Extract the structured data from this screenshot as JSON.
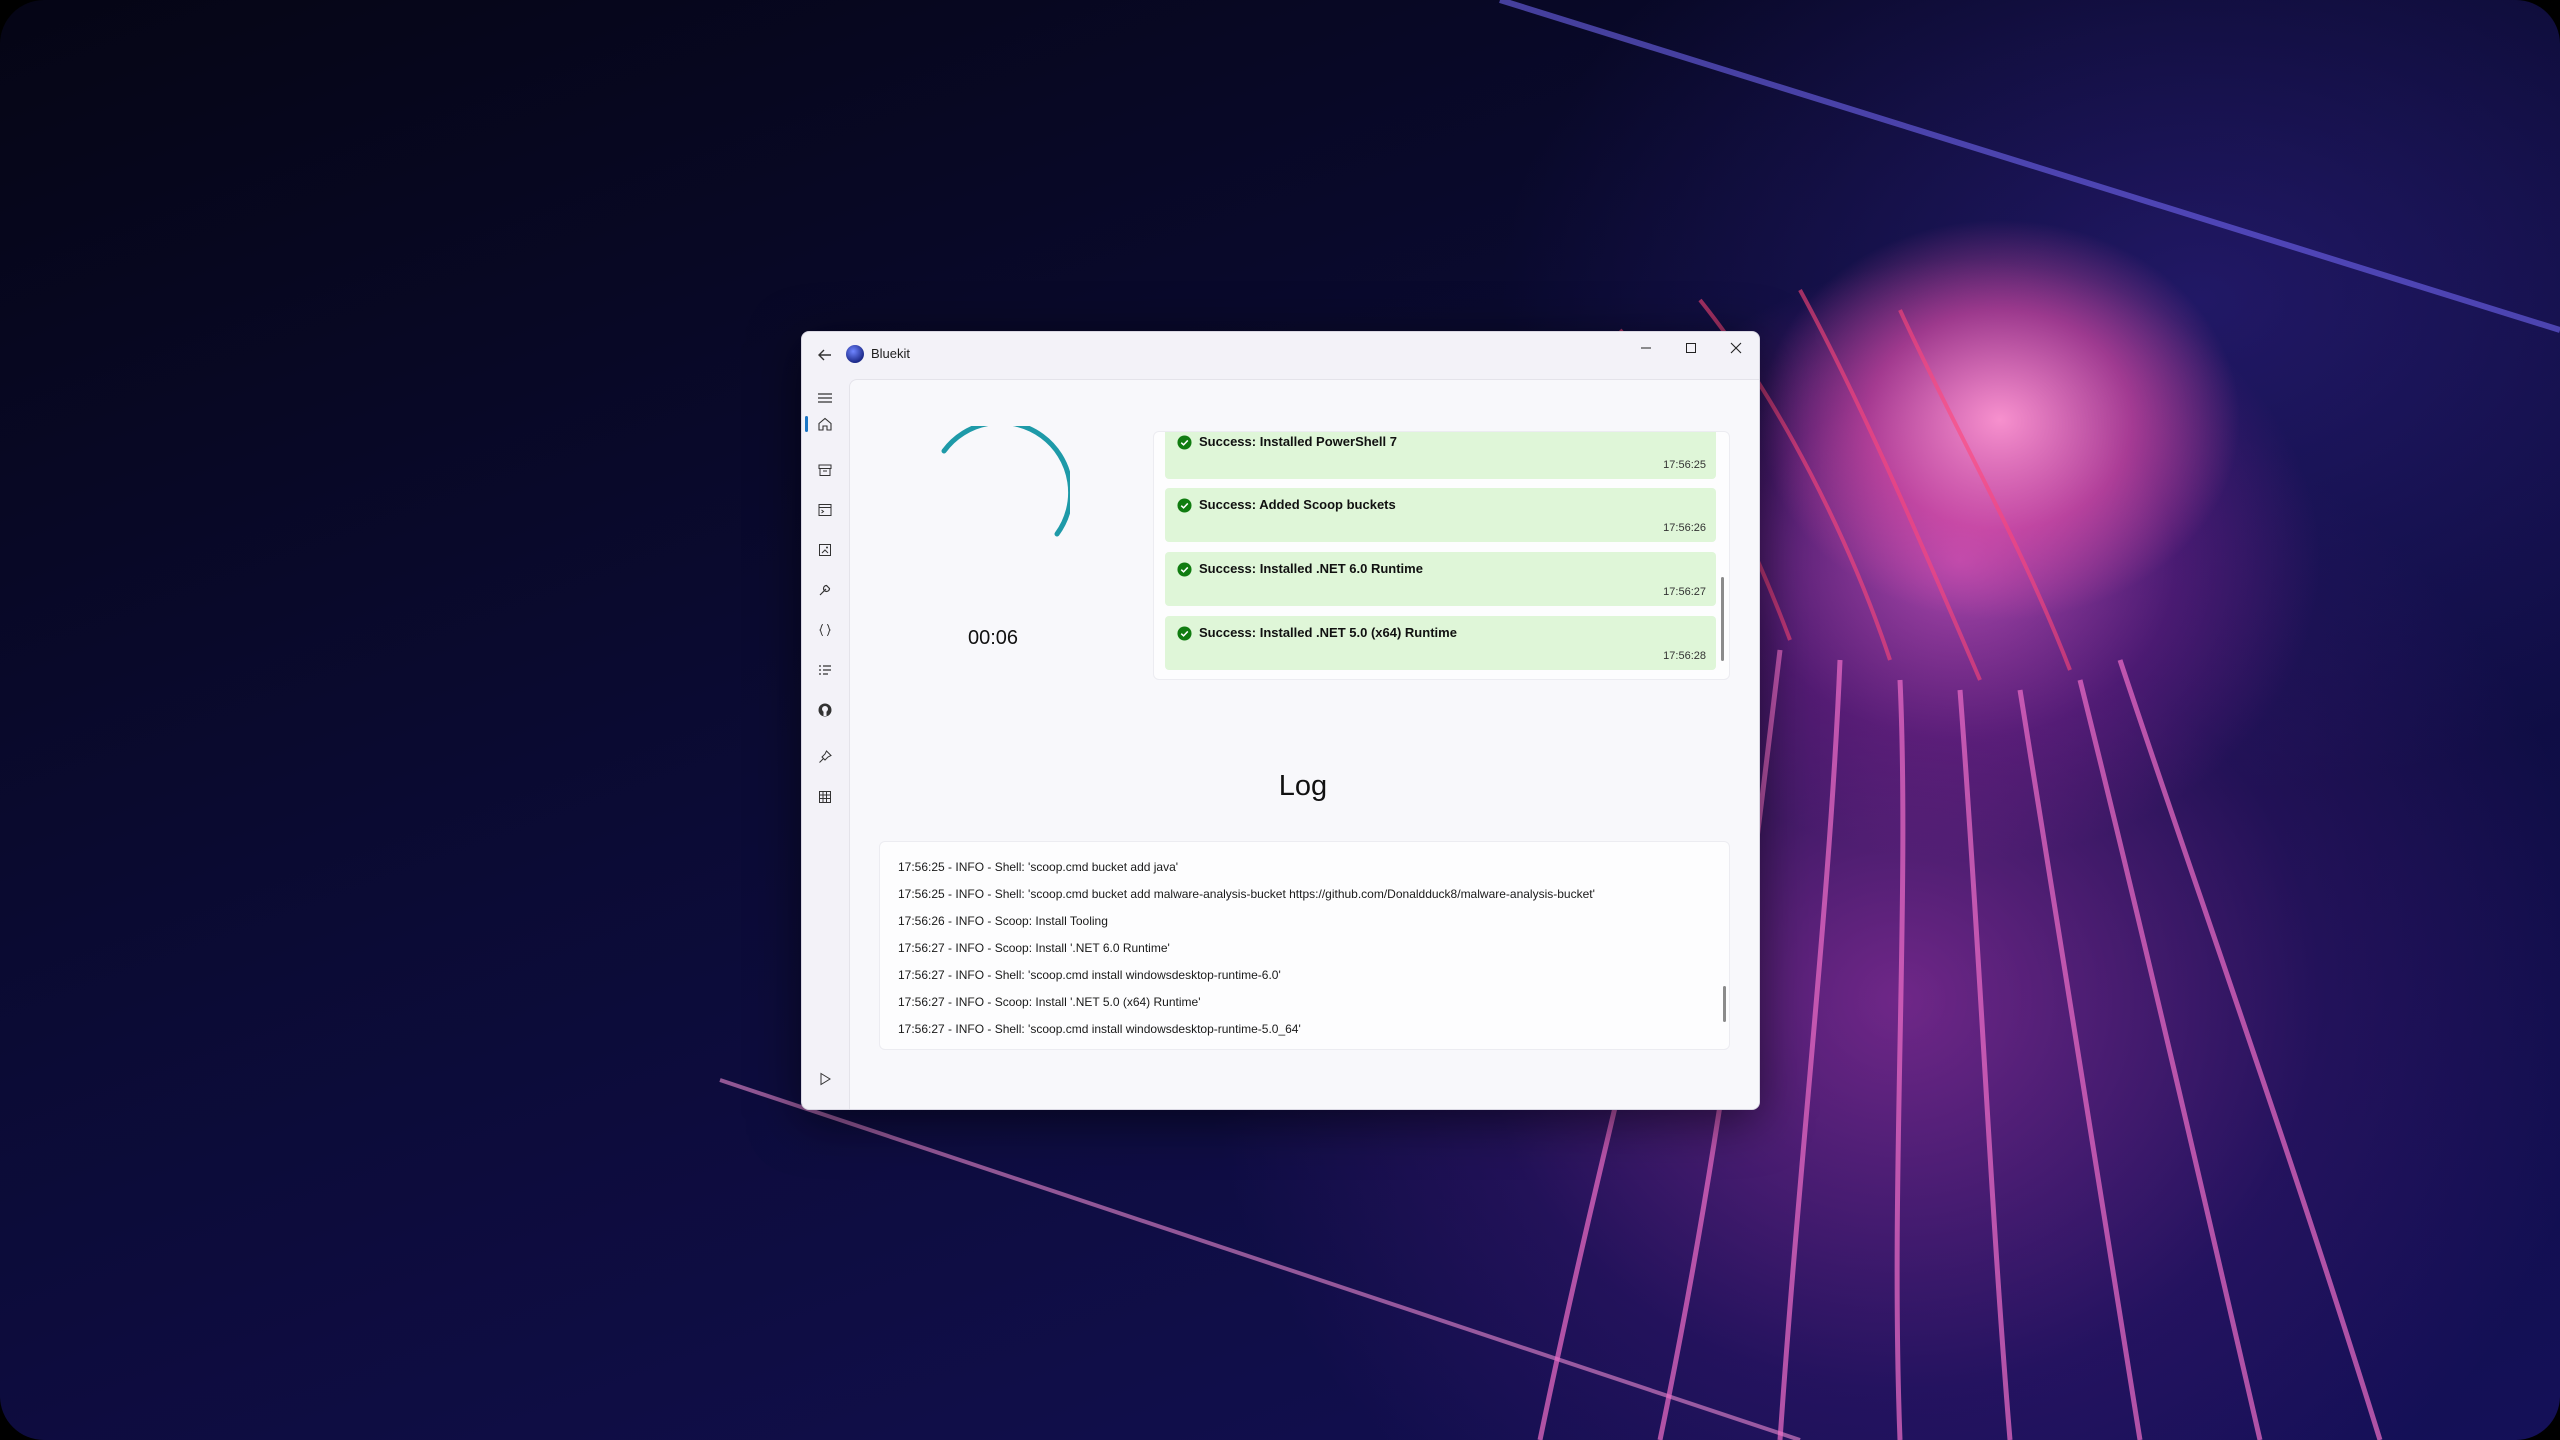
{
  "window": {
    "title": "Bluekit"
  },
  "titlebar": {
    "back_icon": "back-arrow-icon",
    "minimize_icon": "minimize-icon",
    "maximize_icon": "maximize-icon",
    "close_icon": "close-icon"
  },
  "nav": {
    "items": [
      {
        "icon": "hamburger-menu-icon"
      },
      {
        "icon": "home-icon",
        "active": true
      },
      {
        "icon": "archive-box-icon"
      },
      {
        "icon": "window-terminal-icon"
      },
      {
        "icon": "image-document-icon"
      },
      {
        "icon": "tools-wrench-icon"
      },
      {
        "icon": "code-braces-icon"
      },
      {
        "icon": "list-checklist-icon"
      },
      {
        "icon": "github-icon"
      },
      {
        "icon": "pin-icon"
      },
      {
        "icon": "grid-table-icon"
      },
      {
        "icon": "play-icon"
      }
    ],
    "accent": "#1b75c4"
  },
  "progress": {
    "timer": "00:06",
    "spinner_color": "#1e9aa8"
  },
  "status": {
    "items": [
      {
        "message": "Success: Installed PowerShell 7",
        "time": "17:56:25"
      },
      {
        "message": "Success: Added Scoop buckets",
        "time": "17:56:26"
      },
      {
        "message": "Success: Installed .NET 6.0 Runtime",
        "time": "17:56:27"
      },
      {
        "message": "Success: Installed .NET 5.0 (x64) Runtime",
        "time": "17:56:28"
      }
    ],
    "success_color": "#dff6d8",
    "check_color": "#107c10"
  },
  "log": {
    "title": "Log",
    "lines": [
      "17:56:25 - INFO - Shell: 'scoop.cmd bucket add java'",
      "17:56:25 - INFO - Shell: 'scoop.cmd bucket add malware-analysis-bucket https://github.com/Donaldduck8/malware-analysis-bucket'",
      "17:56:26 - INFO - Scoop: Install Tooling",
      "17:56:27 - INFO - Scoop: Install '.NET 6.0 Runtime'",
      "17:56:27 - INFO - Shell: 'scoop.cmd install windowsdesktop-runtime-6.0'",
      "17:56:27 - INFO - Scoop: Install '.NET 5.0 (x64) Runtime'",
      "17:56:27 - INFO - Shell: 'scoop.cmd install windowsdesktop-runtime-5.0_64'"
    ]
  }
}
